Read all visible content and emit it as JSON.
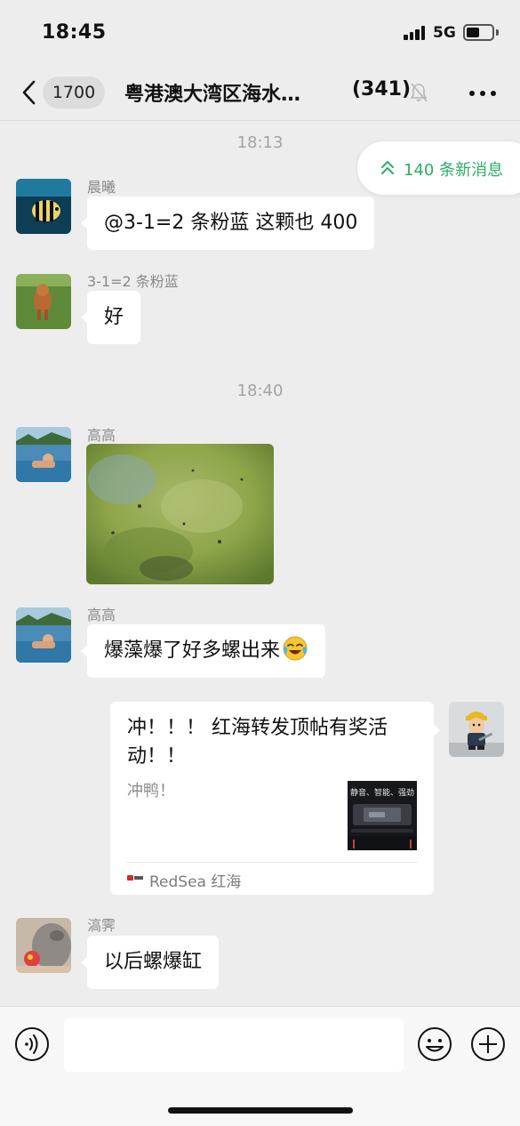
{
  "status_bar": {
    "time": "18:45",
    "network": "5G"
  },
  "nav": {
    "unread_count": "1700",
    "title": "粤港澳大湾区海水…",
    "member_count": "(341)"
  },
  "new_messages": {
    "label": "140 条新消息"
  },
  "timestamps": [
    "18:13",
    "18:40"
  ],
  "messages": [
    {
      "sender": "晨曦",
      "text": "@3-1=2 条粉蓝 这颗也 400"
    },
    {
      "sender": "3-1=2 条粉蓝",
      "text": "好"
    },
    {
      "sender": "高高",
      "type": "image"
    },
    {
      "sender": "高高",
      "text": "爆藻爆了好多螺出来"
    },
    {
      "sender": "me",
      "type": "link",
      "title": "冲！！！ 红海转发顶帖有奖活动！！",
      "desc": "冲鸭！",
      "thumb_text": "静音、智能、强劲",
      "source": "RedSea 红海"
    },
    {
      "sender": "滈霁",
      "text": "以后螺爆缸"
    }
  ],
  "colors": {
    "accent": "#2aae67",
    "background": "#ededed"
  }
}
